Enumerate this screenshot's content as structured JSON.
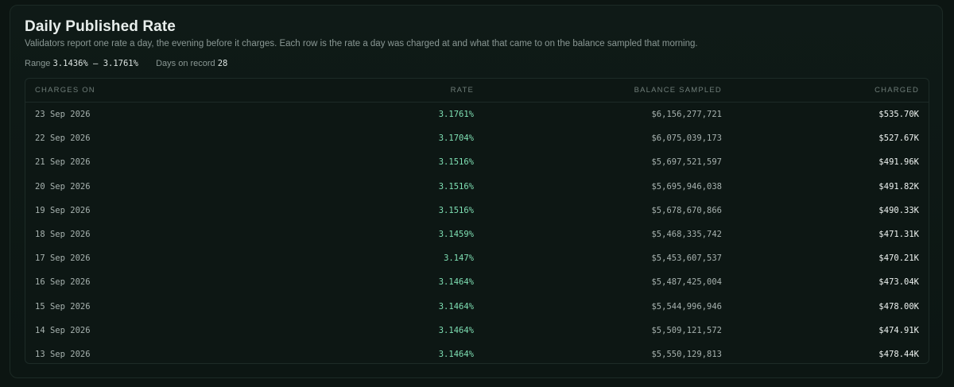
{
  "panel": {
    "title": "Daily Published Rate",
    "subtitle": "Validators report one rate a day, the evening before it charges. Each row is the rate a day was charged at and what that came to on the balance sampled that morning.",
    "range_label": "Range",
    "range_value": "3.1436% – 3.1761%",
    "days_label": "Days on record",
    "days_value": "28"
  },
  "table": {
    "headers": {
      "charges_on": "CHARGES ON",
      "rate": "RATE",
      "balance": "BALANCE SAMPLED",
      "charged": "CHARGED"
    },
    "rows": [
      {
        "date": "23 Sep 2026",
        "rate": "3.1761%",
        "balance": "$6,156,277,721",
        "charged": "$535.70K"
      },
      {
        "date": "22 Sep 2026",
        "rate": "3.1704%",
        "balance": "$6,075,039,173",
        "charged": "$527.67K"
      },
      {
        "date": "21 Sep 2026",
        "rate": "3.1516%",
        "balance": "$5,697,521,597",
        "charged": "$491.96K"
      },
      {
        "date": "20 Sep 2026",
        "rate": "3.1516%",
        "balance": "$5,695,946,038",
        "charged": "$491.82K"
      },
      {
        "date": "19 Sep 2026",
        "rate": "3.1516%",
        "balance": "$5,678,670,866",
        "charged": "$490.33K"
      },
      {
        "date": "18 Sep 2026",
        "rate": "3.1459%",
        "balance": "$5,468,335,742",
        "charged": "$471.31K"
      },
      {
        "date": "17 Sep 2026",
        "rate": "3.147%",
        "balance": "$5,453,607,537",
        "charged": "$470.21K"
      },
      {
        "date": "16 Sep 2026",
        "rate": "3.1464%",
        "balance": "$5,487,425,004",
        "charged": "$473.04K"
      },
      {
        "date": "15 Sep 2026",
        "rate": "3.1464%",
        "balance": "$5,544,996,946",
        "charged": "$478.00K"
      },
      {
        "date": "14 Sep 2026",
        "rate": "3.1464%",
        "balance": "$5,509,121,572",
        "charged": "$474.91K"
      },
      {
        "date": "13 Sep 2026",
        "rate": "3.1464%",
        "balance": "$5,550,129,813",
        "charged": "$478.44K"
      }
    ]
  },
  "colors": {
    "background": "#0c1512",
    "rate_accent": "#7fe0b4",
    "title": "#e8eeec",
    "muted": "#8a9894"
  }
}
